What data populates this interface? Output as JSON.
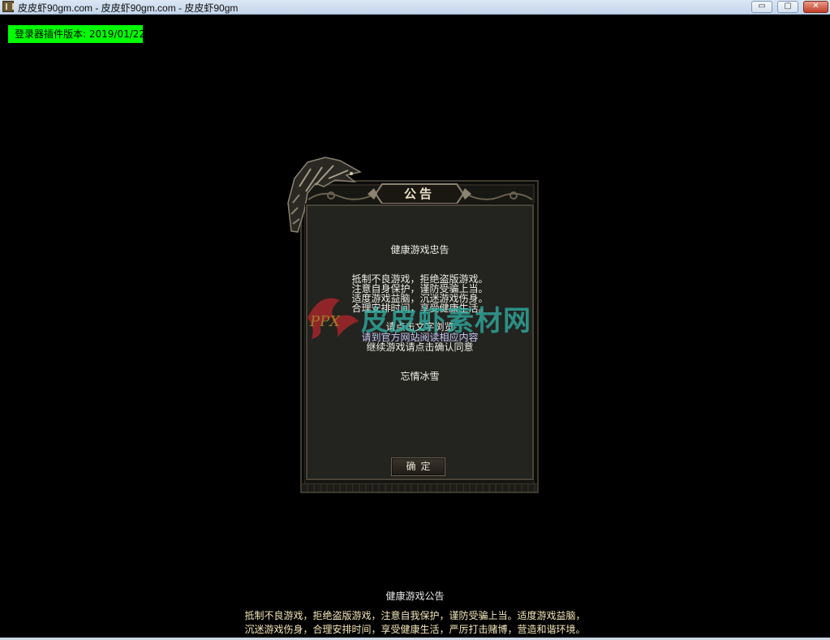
{
  "window": {
    "title": "皮皮虾90gm.com - 皮皮虾90gm.com - 皮皮虾90gm",
    "min_glyph": "▭",
    "max_glyph": "▢",
    "close_glyph": "✕"
  },
  "version_badge": "登录器插件版本: 2019/01/22",
  "dialog": {
    "title": "公告",
    "heading": "健康游戏忠告",
    "lines": [
      "抵制不良游戏，拒绝盗版游戏。",
      "注意自身保护，谨防受骗上当。",
      "适度游戏益脑，沉迷游戏伤身。",
      "合理安排时间，享受健康生活。"
    ],
    "line_extra": "请点击文字浏览",
    "link_line": "请到官方网站阅读相应内容",
    "continue_line": "继续游戏请点击确认同意",
    "signature": "忘情冰雪",
    "ok_label": "确定"
  },
  "watermark": "皮皮虾素材网",
  "footer": {
    "title": "健康游戏公告",
    "line1": "抵制不良游戏，拒绝盗版游戏，注意自我保护，谨防受骗上当。适度游戏益脑，",
    "line2": "沉迷游戏伤身，合理安排时间，享受健康生活，严厉打击赌博，营造和谐环境。"
  },
  "colors": {
    "badge_bg": "#00ff00",
    "watermark": "#2fb3a8",
    "footer_text": "#f4e7b8"
  }
}
